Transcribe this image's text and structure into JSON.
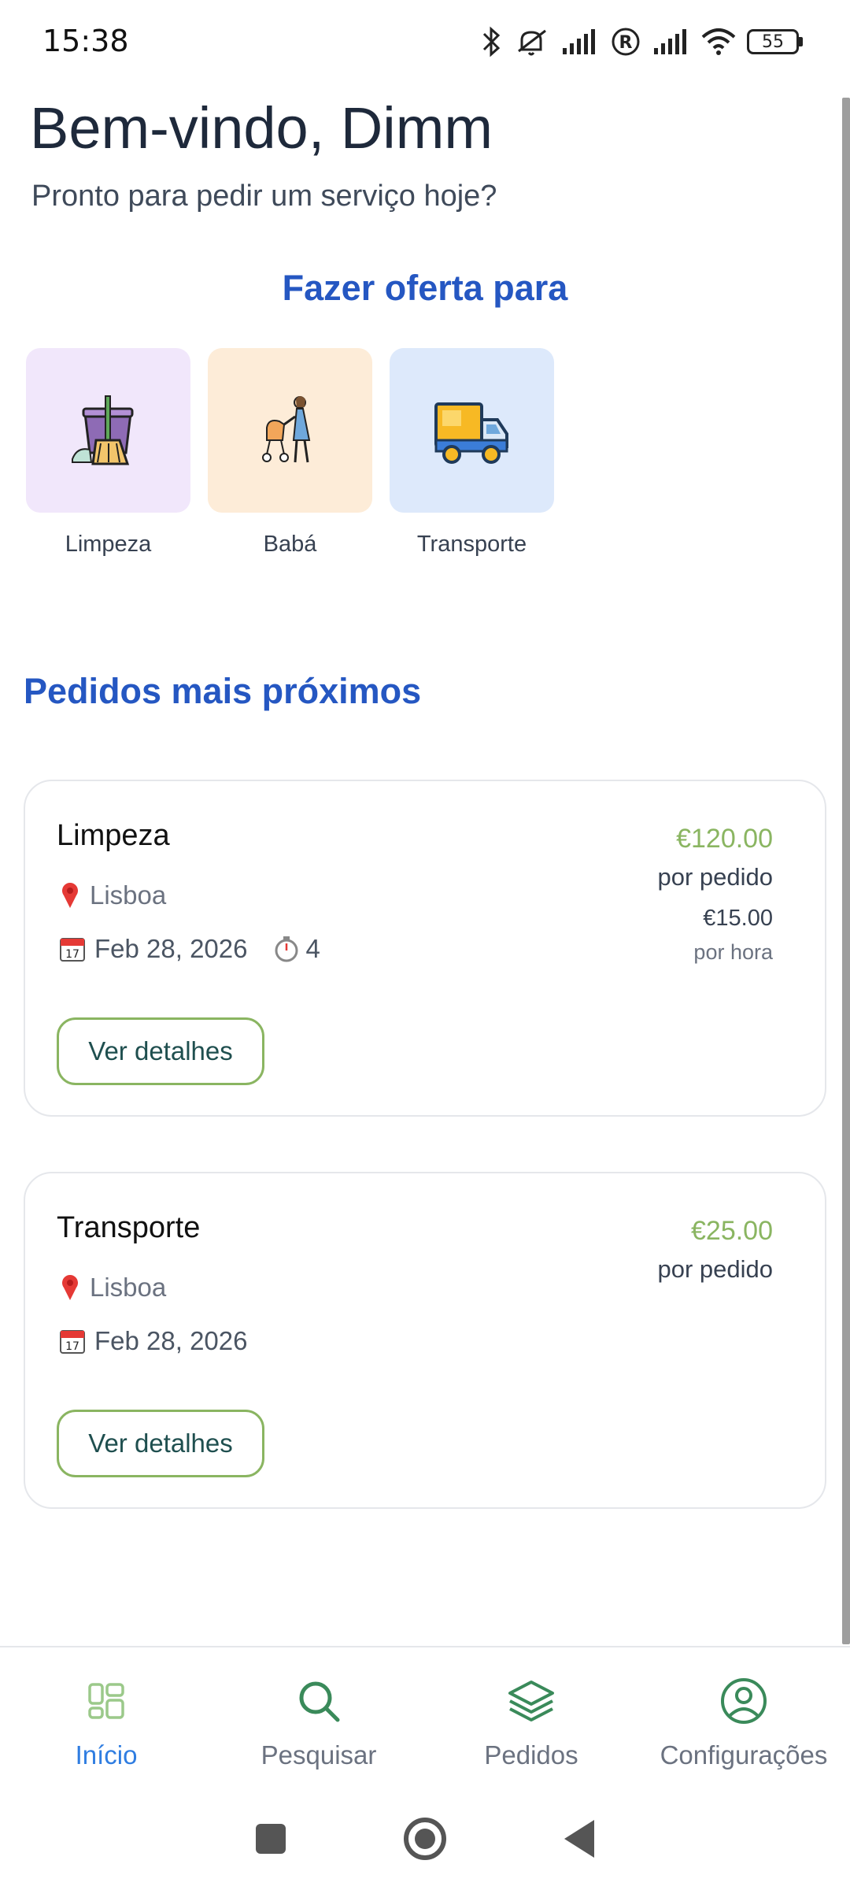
{
  "status_bar": {
    "time": "15:38",
    "battery_level": "55",
    "icons": [
      "bluetooth-icon",
      "mute-icon",
      "signal-icon",
      "roaming-icon",
      "signal-icon",
      "wifi-icon",
      "battery-icon"
    ]
  },
  "header": {
    "title": "Bem-vindo, Dimm",
    "subtitle": "Pronto para pedir um serviço hoje?"
  },
  "offer_section": {
    "heading": "Fazer oferta para",
    "categories": [
      {
        "label": "Limpeza",
        "icon": "cleaning-bucket-icon",
        "tile_color": "#f1e7fb"
      },
      {
        "label": "Babá",
        "icon": "nanny-stroller-icon",
        "tile_color": "#fdecd8"
      },
      {
        "label": "Transporte",
        "icon": "delivery-truck-icon",
        "tile_color": "#dde9fb"
      }
    ]
  },
  "nearby_section": {
    "heading": "Pedidos mais próximos",
    "orders": [
      {
        "title": "Limpeza",
        "location": "Lisboa",
        "date": "Feb 28, 2026",
        "duration": "4",
        "price": "€120.00",
        "price_unit": "por pedido",
        "hourly_price": "€15.00",
        "hourly_unit": "por hora",
        "button_label": "Ver detalhes"
      },
      {
        "title": "Transporte",
        "location": "Lisboa",
        "date": "Feb 28, 2026",
        "price": "€25.00",
        "price_unit": "por pedido",
        "button_label": "Ver detalhes"
      }
    ]
  },
  "bottom_nav": {
    "items": [
      {
        "label": "Início",
        "icon": "grid-icon",
        "active": true
      },
      {
        "label": "Pesquisar",
        "icon": "search-icon",
        "active": false
      },
      {
        "label": "Pedidos",
        "icon": "layers-icon",
        "active": false
      },
      {
        "label": "Configurações",
        "icon": "user-circle-icon",
        "active": false
      }
    ]
  },
  "colors": {
    "heading_blue": "#2557c2",
    "price_green": "#8ab561",
    "nav_green": "#3a8a5a",
    "active_blue": "#2f7de1"
  }
}
